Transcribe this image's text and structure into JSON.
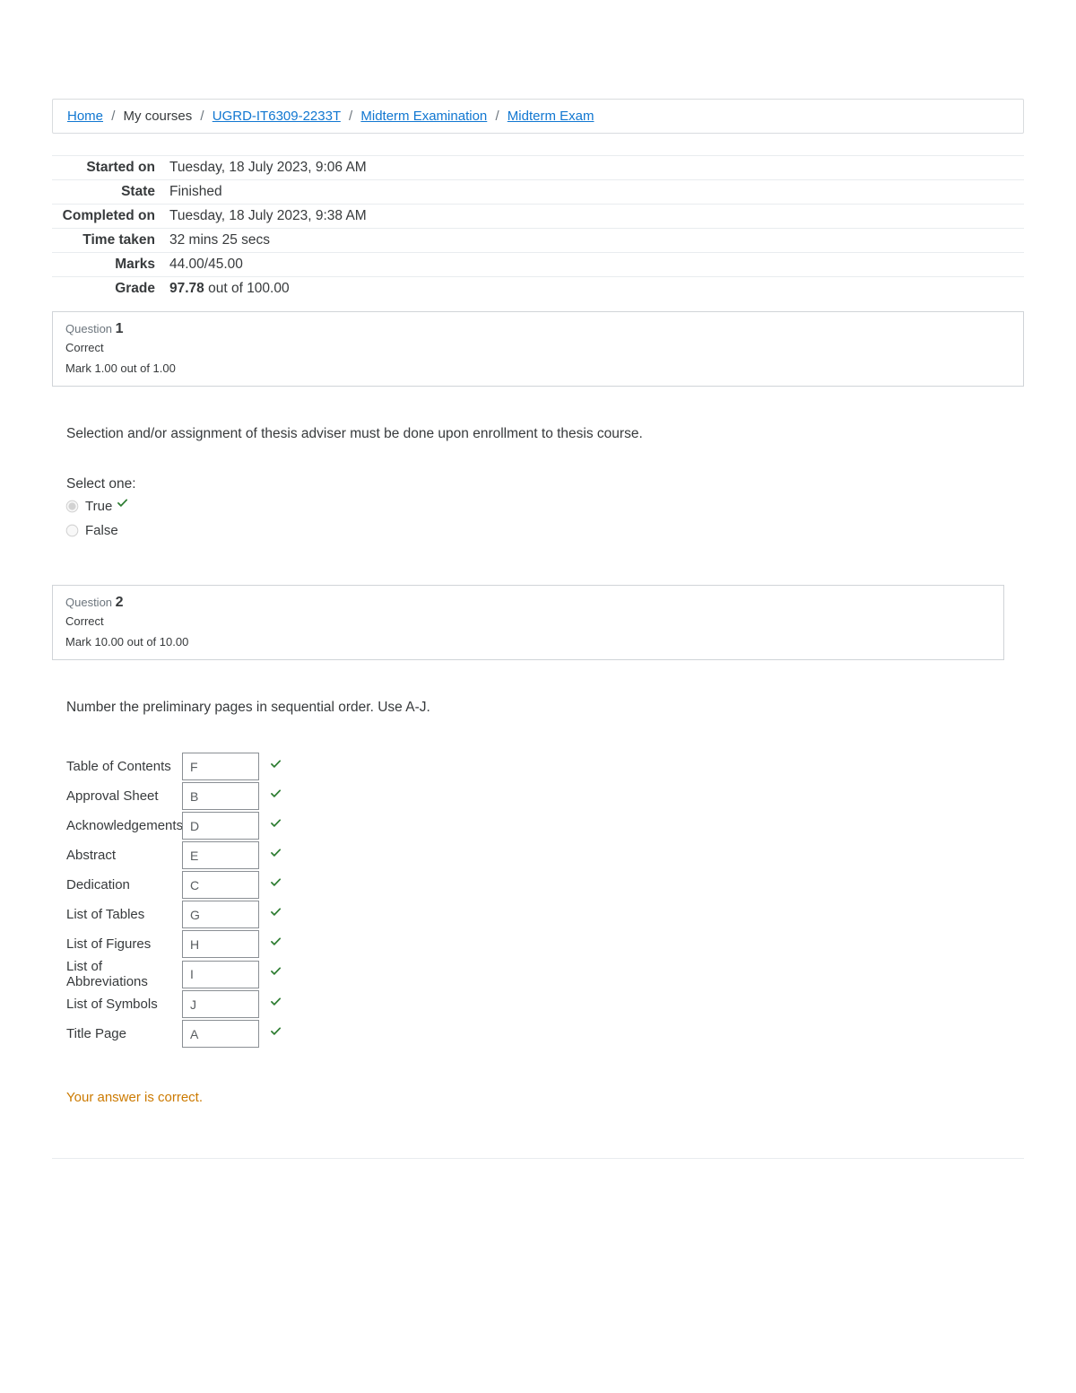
{
  "breadcrumb": {
    "home": "Home",
    "mycourses": "My courses",
    "course": "UGRD-IT6309-2233T",
    "section": "Midterm Examination",
    "activity": "Midterm Exam"
  },
  "attempt": {
    "labels": {
      "started": "Started on",
      "state": "State",
      "completed": "Completed on",
      "time": "Time taken",
      "marks": "Marks",
      "grade": "Grade"
    },
    "started": "Tuesday, 18 July 2023, 9:06 AM",
    "state": "Finished",
    "completed": "Tuesday, 18 July 2023, 9:38 AM",
    "time": "32 mins 25 secs",
    "marks": "44.00/45.00",
    "grade_bold": "97.78",
    "grade_rest": " out of 100.00"
  },
  "q1": {
    "q_word": "Question ",
    "num": "1",
    "state": "Correct",
    "mark": "Mark 1.00 out of 1.00",
    "text": "Selection and/or assignment of thesis adviser must be done upon enrollment to thesis course.",
    "prompt": "Select one:",
    "opt_true": "True",
    "opt_false": "False"
  },
  "q2": {
    "q_word": "Question ",
    "num": "2",
    "state": "Correct",
    "mark": "Mark 10.00 out of 10.00",
    "text": "Number the preliminary pages in sequential order. Use A-J.",
    "rows": [
      {
        "label": "Table of Contents",
        "value": "F"
      },
      {
        "label": "Approval Sheet",
        "value": "B"
      },
      {
        "label": "Acknowledgements",
        "value": "D"
      },
      {
        "label": "Abstract",
        "value": "E"
      },
      {
        "label": "Dedication",
        "value": "C"
      },
      {
        "label": "List of Tables",
        "value": "G"
      },
      {
        "label": "List of Figures",
        "value": "H"
      },
      {
        "label": "List of Abbreviations",
        "value": "I"
      },
      {
        "label": "List of Symbols",
        "value": "J"
      },
      {
        "label": "Title Page",
        "value": "A"
      }
    ],
    "feedback": "Your answer is correct."
  }
}
